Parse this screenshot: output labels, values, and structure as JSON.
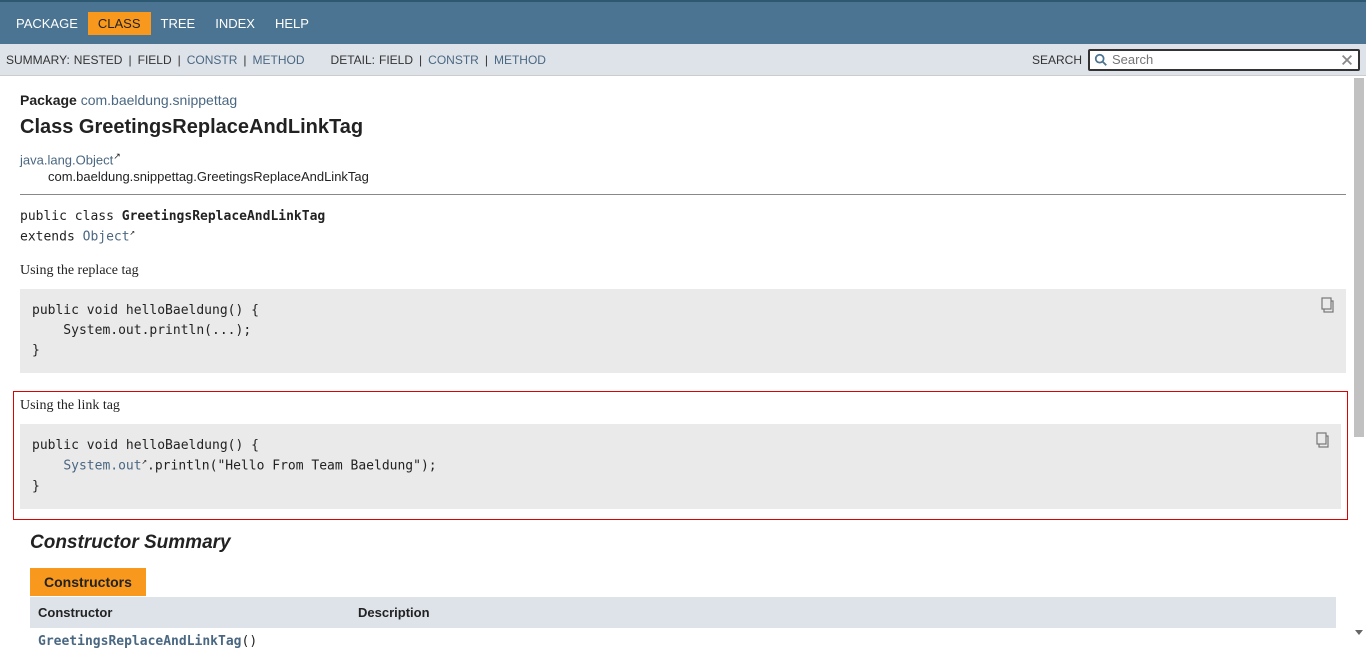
{
  "topnav": {
    "package": "PACKAGE",
    "class": "CLASS",
    "tree": "TREE",
    "index": "INDEX",
    "help": "HELP"
  },
  "subnav": {
    "summary_label": "SUMMARY:",
    "nested": "NESTED",
    "field": "FIELD",
    "constr": "CONSTR",
    "method": "METHOD",
    "detail_label": "DETAIL:",
    "d_field": "FIELD",
    "d_constr": "CONSTR",
    "d_method": "METHOD",
    "search_label": "SEARCH",
    "search_placeholder": "Search"
  },
  "header": {
    "package_label": "Package",
    "package_link": "com.baeldung.snippettag",
    "class_title": "Class GreetingsReplaceAndLinkTag"
  },
  "inheritance": {
    "lvl1": "java.lang.Object",
    "lvl2": "com.baeldung.snippettag.GreetingsReplaceAndLinkTag"
  },
  "signature": {
    "prefix": "public class ",
    "classname": "GreetingsReplaceAndLinkTag",
    "extends_prefix": "extends ",
    "extends_link": "Object"
  },
  "desc1": "Using the replace tag",
  "snippet1": "public void helloBaeldung() {\n    System.out.println(...);\n}",
  "desc2": "Using the link tag",
  "snippet2_line1": "public void helloBaeldung() {",
  "snippet2_line2_prefix": "    ",
  "snippet2_line2_link": "System.out",
  "snippet2_line2_suffix": ".println(\"Hello From Team Baeldung\");",
  "snippet2_line3": "}",
  "constructor_summary": {
    "title": "Constructor Summary",
    "tab": "Constructors",
    "col_constructor": "Constructor",
    "col_description": "Description",
    "row1_link": "GreetingsReplaceAndLinkTag",
    "row1_suffix": "()"
  }
}
